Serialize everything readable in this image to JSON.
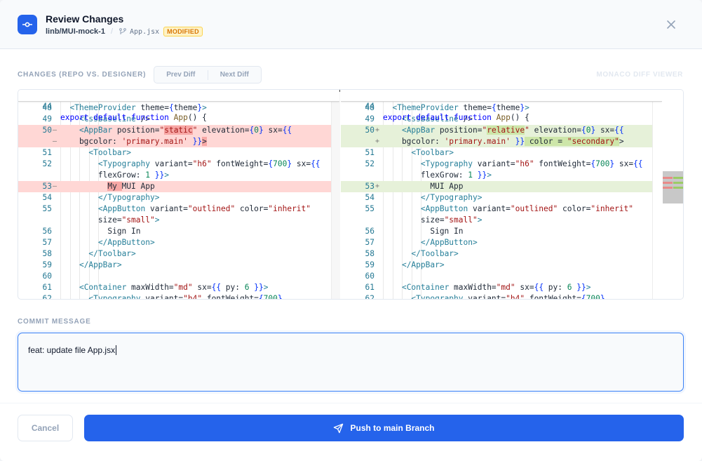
{
  "header": {
    "title": "Review Changes",
    "repo": "linb/MUI-mock-1",
    "file": "App.jsx",
    "status_badge": "MODIFIED"
  },
  "toolbar": {
    "changes_label": "CHANGES (REPO VS. DESIGNER)",
    "prev_diff": "Prev Diff",
    "next_diff": "Next Diff",
    "viewer_label": "MONACO DIFF VIEWER"
  },
  "diff": {
    "sticky": {
      "num": "44",
      "text": "export default function App() {"
    },
    "left_line_numbers": [
      "48",
      "49",
      "50",
      "",
      "51",
      "52",
      "",
      "53",
      "54",
      "55",
      "",
      "56",
      "57",
      "58",
      "59",
      "60",
      "61",
      "62"
    ],
    "right_line_numbers": [
      "48",
      "49",
      "50",
      "",
      "51",
      "52",
      "",
      "53",
      "54",
      "55",
      "",
      "56",
      "57",
      "58",
      "59",
      "60",
      "61",
      "62"
    ]
  },
  "commit": {
    "label": "COMMIT MESSAGE",
    "message": "feat: update file App.jsx"
  },
  "footer": {
    "cancel_label": "Cancel",
    "push_label": "Push to main Branch"
  },
  "colors": {
    "accent": "#2563eb",
    "badge_bg": "#fef3c7",
    "badge_text": "#d97706",
    "deleted_line": "#ffd7d5",
    "inserted_line": "#e6f1d9"
  },
  "icons": [
    "git-commit-icon",
    "git-branch-icon",
    "close-icon",
    "send-icon"
  ]
}
